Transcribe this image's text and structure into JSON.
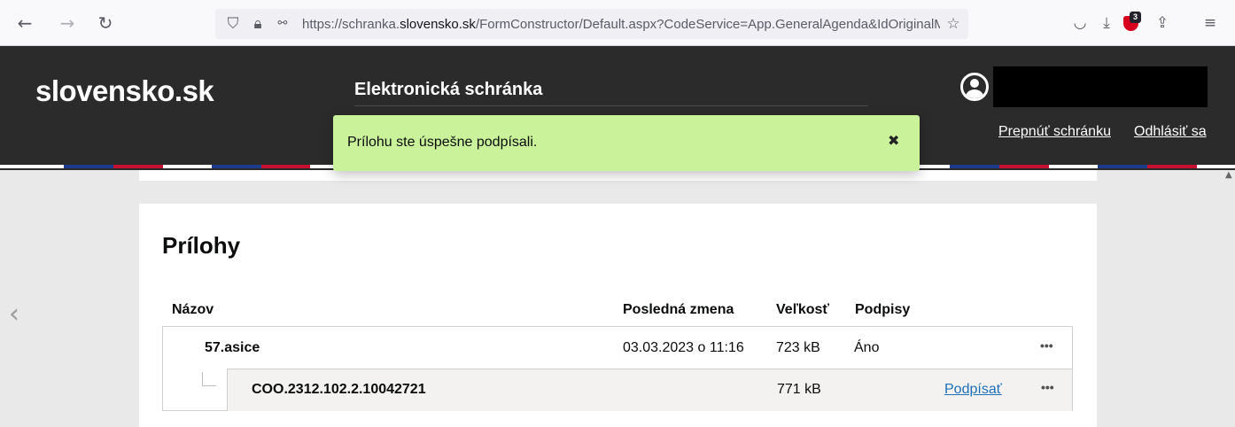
{
  "browser": {
    "url_prefix": "https://schranka.",
    "url_host": "slovensko.sk",
    "url_rest": "/FormConstructor/Default.aspx?CodeService=App.GeneralAgenda&IdOriginalM",
    "extension_badge": "3"
  },
  "header": {
    "logo": "slovensko.sk",
    "app_title": "Elektronická schránka",
    "switch_link": "Prepnúť schránku",
    "logout_link": "Odhlásiť sa"
  },
  "toast": {
    "message": "Prílohu ste úspešne podpísali.",
    "close": "✖"
  },
  "attachments": {
    "title": "Prílohy",
    "columns": {
      "name": "Názov",
      "modified": "Posledná zmena",
      "size": "Veľkosť",
      "signatures": "Podpisy"
    },
    "rows": [
      {
        "name": "57.asice",
        "modified": "03.03.2023 o 11:16",
        "size": "723 kB",
        "signatures": "Áno",
        "more": "•••"
      },
      {
        "name": "COO.2312.102.2.10042721",
        "modified": "",
        "size": "771 kB",
        "action": "Podpísať",
        "more": "•••"
      }
    ]
  },
  "colors": {
    "header_bg": "#2b2b2b",
    "toast_bg": "#c9f29b",
    "link": "#1d70b8",
    "stripe_blue": "#1e3a8a",
    "stripe_red": "#c8102e"
  }
}
